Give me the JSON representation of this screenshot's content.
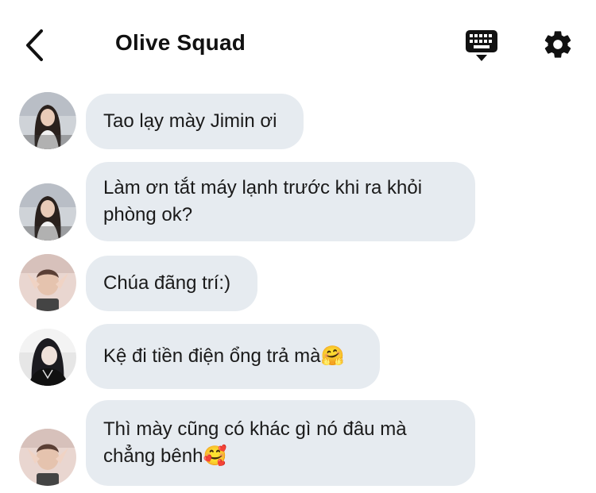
{
  "header": {
    "title": "Olive Squad",
    "back_icon": "chevron-left-icon",
    "keyboard_icon": "keyboard-icon",
    "settings_icon": "gear-icon"
  },
  "messages": [
    {
      "text": "Tao lạy mày Jimin ơi",
      "avatar": "avatar-girl-longhair"
    },
    {
      "text": "Làm ơn tắt máy lạnh trước khi ra khỏi phòng ok?",
      "avatar": "avatar-girl-longhair"
    },
    {
      "text": "Chúa đãng trí:)",
      "avatar": "avatar-boy-pink"
    },
    {
      "text": "Kệ đi tiền điện ổng trả mà🤗",
      "avatar": "avatar-dark"
    },
    {
      "text": "Thì mày cũng có khác gì nó đâu mà chẳng bênh🥰",
      "avatar": "avatar-boy-pink"
    }
  ],
  "colors": {
    "bubble": "#e6ebf0",
    "text": "#1a1a1a",
    "icon": "#111111"
  }
}
